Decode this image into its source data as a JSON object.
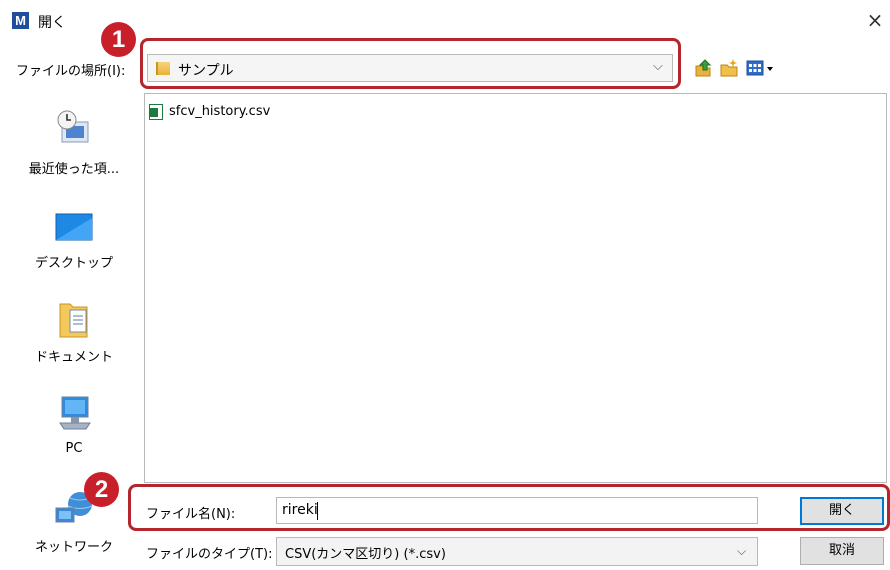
{
  "window": {
    "app_icon_letter": "M",
    "title": "開く",
    "close_glyph": "×"
  },
  "location": {
    "label": "ファイルの場所(I):",
    "value": "サンプル",
    "caret": "⌵"
  },
  "annotations": {
    "badge1": "1",
    "badge2": "2",
    "highlight_color": "#b3262d",
    "badge_color": "#c8202a"
  },
  "toolbar": {
    "icons": [
      "up-folder-icon",
      "new-folder-icon",
      "view-menu-icon"
    ]
  },
  "sidebar": {
    "items": [
      {
        "label": "最近使った項...",
        "icon": "recent-places-icon"
      },
      {
        "label": "デスクトップ",
        "icon": "desktop-icon"
      },
      {
        "label": "ドキュメント",
        "icon": "documents-icon"
      },
      {
        "label": "PC",
        "icon": "pc-icon"
      },
      {
        "label": "ネットワーク",
        "icon": "network-icon"
      }
    ]
  },
  "files": [
    {
      "name": "sfcv_history.csv",
      "icon": "excel-csv-icon"
    }
  ],
  "filename": {
    "label": "ファイル名(N):",
    "value": "rireki"
  },
  "filetype": {
    "label": "ファイルのタイプ(T):",
    "value": "CSV(カンマ区切り) (*.csv)",
    "caret": "⌵"
  },
  "buttons": {
    "open": "開く",
    "cancel": "取消"
  },
  "colors": {
    "accent": "#0078d7"
  }
}
